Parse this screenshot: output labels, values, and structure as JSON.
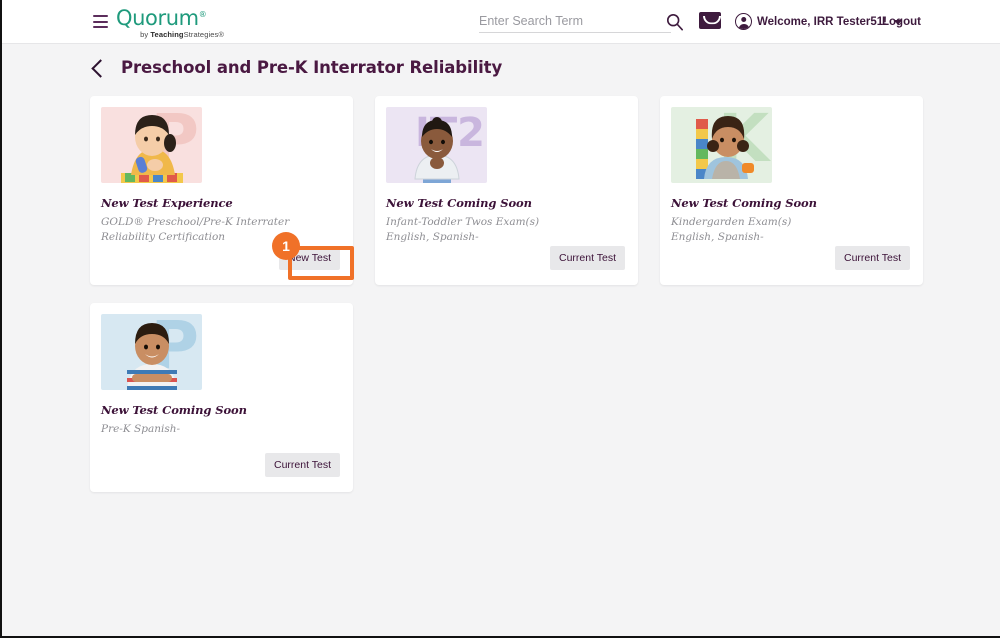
{
  "header": {
    "menu_icon": "hamburger-menu-icon",
    "logo_text": "Quorum",
    "logo_registered": "®",
    "logo_sub_bold": "Teaching",
    "logo_sub_rest": "Strategies®",
    "search_placeholder": "Enter Search Term",
    "search_value": "",
    "search_icon": "search-icon",
    "mail_icon": "mail-envelope-icon",
    "avatar_icon": "user-avatar-icon",
    "user_greeting": "Welcome, IRR Tester51!",
    "chevron_icon": "chevron-down-icon",
    "logout_label": "Logout"
  },
  "page": {
    "back_icon": "back-chevron-icon",
    "title": "Preschool and Pre-K Interrator Reliability"
  },
  "cards": [
    {
      "thumb_letter": "P",
      "thumb_bg": "#f9e0df",
      "thumb_letter_color": "#f2c8c4",
      "thumb_alt": "toddler-playing-with-blocks-photo",
      "title": "New Test Experience",
      "desc": "GOLD® Preschool/Pre-K Interrater Reliability Certification",
      "button_label": "New Test",
      "button_name": "new-test-button"
    },
    {
      "thumb_letter": "IT2",
      "thumb_bg": "#ece5f3",
      "thumb_letter_color": "#c9b6de",
      "thumb_alt": "smiling-infant-photo",
      "title": "New Test Coming Soon",
      "desc": "Infant-Toddler Twos Exam(s)\nEnglish, Spanish-",
      "button_label": "Current Test",
      "button_name": "current-test-button"
    },
    {
      "thumb_letter": "K",
      "thumb_bg": "#e4f0e2",
      "thumb_letter_color": "#c3dfc0",
      "thumb_alt": "child-stacking-blocks-photo",
      "title": "New Test Coming Soon",
      "desc": "Kindergarden Exam(s)\nEnglish, Spanish-",
      "button_label": "Current Test",
      "button_name": "current-test-button"
    },
    {
      "thumb_letter": "P",
      "thumb_bg": "#d7e8f2",
      "thumb_letter_color": "#afd2e6",
      "thumb_alt": "boy-with-crossed-arms-photo",
      "title": "New Test Coming Soon",
      "desc": "Pre-K Spanish-",
      "button_label": "Current Test",
      "button_name": "current-test-button"
    }
  ],
  "annotation": {
    "badge_number": "1",
    "color": "#f07128",
    "target": "new-test-button"
  },
  "colors": {
    "brand_green": "#1f9a7c",
    "brand_purple": "#3e1b3e",
    "title_purple": "#4a1942",
    "page_bg": "#f4f4f5",
    "card_bg": "#ffffff",
    "button_bg": "#e8e8ea",
    "annotation_orange": "#f07128"
  }
}
